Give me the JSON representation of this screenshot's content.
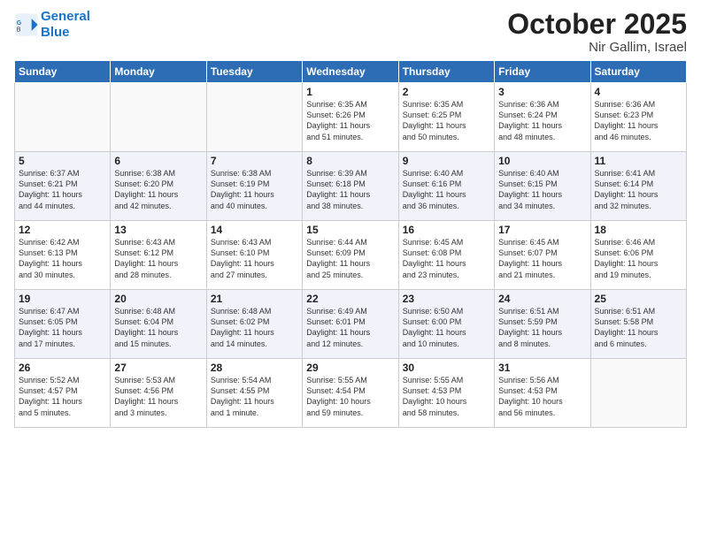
{
  "header": {
    "logo_line1": "General",
    "logo_line2": "Blue",
    "month": "October 2025",
    "location": "Nir Gallim, Israel"
  },
  "weekdays": [
    "Sunday",
    "Monday",
    "Tuesday",
    "Wednesday",
    "Thursday",
    "Friday",
    "Saturday"
  ],
  "weeks": [
    [
      {
        "day": "",
        "info": ""
      },
      {
        "day": "",
        "info": ""
      },
      {
        "day": "",
        "info": ""
      },
      {
        "day": "1",
        "info": "Sunrise: 6:35 AM\nSunset: 6:26 PM\nDaylight: 11 hours\nand 51 minutes."
      },
      {
        "day": "2",
        "info": "Sunrise: 6:35 AM\nSunset: 6:25 PM\nDaylight: 11 hours\nand 50 minutes."
      },
      {
        "day": "3",
        "info": "Sunrise: 6:36 AM\nSunset: 6:24 PM\nDaylight: 11 hours\nand 48 minutes."
      },
      {
        "day": "4",
        "info": "Sunrise: 6:36 AM\nSunset: 6:23 PM\nDaylight: 11 hours\nand 46 minutes."
      }
    ],
    [
      {
        "day": "5",
        "info": "Sunrise: 6:37 AM\nSunset: 6:21 PM\nDaylight: 11 hours\nand 44 minutes."
      },
      {
        "day": "6",
        "info": "Sunrise: 6:38 AM\nSunset: 6:20 PM\nDaylight: 11 hours\nand 42 minutes."
      },
      {
        "day": "7",
        "info": "Sunrise: 6:38 AM\nSunset: 6:19 PM\nDaylight: 11 hours\nand 40 minutes."
      },
      {
        "day": "8",
        "info": "Sunrise: 6:39 AM\nSunset: 6:18 PM\nDaylight: 11 hours\nand 38 minutes."
      },
      {
        "day": "9",
        "info": "Sunrise: 6:40 AM\nSunset: 6:16 PM\nDaylight: 11 hours\nand 36 minutes."
      },
      {
        "day": "10",
        "info": "Sunrise: 6:40 AM\nSunset: 6:15 PM\nDaylight: 11 hours\nand 34 minutes."
      },
      {
        "day": "11",
        "info": "Sunrise: 6:41 AM\nSunset: 6:14 PM\nDaylight: 11 hours\nand 32 minutes."
      }
    ],
    [
      {
        "day": "12",
        "info": "Sunrise: 6:42 AM\nSunset: 6:13 PM\nDaylight: 11 hours\nand 30 minutes."
      },
      {
        "day": "13",
        "info": "Sunrise: 6:43 AM\nSunset: 6:12 PM\nDaylight: 11 hours\nand 28 minutes."
      },
      {
        "day": "14",
        "info": "Sunrise: 6:43 AM\nSunset: 6:10 PM\nDaylight: 11 hours\nand 27 minutes."
      },
      {
        "day": "15",
        "info": "Sunrise: 6:44 AM\nSunset: 6:09 PM\nDaylight: 11 hours\nand 25 minutes."
      },
      {
        "day": "16",
        "info": "Sunrise: 6:45 AM\nSunset: 6:08 PM\nDaylight: 11 hours\nand 23 minutes."
      },
      {
        "day": "17",
        "info": "Sunrise: 6:45 AM\nSunset: 6:07 PM\nDaylight: 11 hours\nand 21 minutes."
      },
      {
        "day": "18",
        "info": "Sunrise: 6:46 AM\nSunset: 6:06 PM\nDaylight: 11 hours\nand 19 minutes."
      }
    ],
    [
      {
        "day": "19",
        "info": "Sunrise: 6:47 AM\nSunset: 6:05 PM\nDaylight: 11 hours\nand 17 minutes."
      },
      {
        "day": "20",
        "info": "Sunrise: 6:48 AM\nSunset: 6:04 PM\nDaylight: 11 hours\nand 15 minutes."
      },
      {
        "day": "21",
        "info": "Sunrise: 6:48 AM\nSunset: 6:02 PM\nDaylight: 11 hours\nand 14 minutes."
      },
      {
        "day": "22",
        "info": "Sunrise: 6:49 AM\nSunset: 6:01 PM\nDaylight: 11 hours\nand 12 minutes."
      },
      {
        "day": "23",
        "info": "Sunrise: 6:50 AM\nSunset: 6:00 PM\nDaylight: 11 hours\nand 10 minutes."
      },
      {
        "day": "24",
        "info": "Sunrise: 6:51 AM\nSunset: 5:59 PM\nDaylight: 11 hours\nand 8 minutes."
      },
      {
        "day": "25",
        "info": "Sunrise: 6:51 AM\nSunset: 5:58 PM\nDaylight: 11 hours\nand 6 minutes."
      }
    ],
    [
      {
        "day": "26",
        "info": "Sunrise: 5:52 AM\nSunset: 4:57 PM\nDaylight: 11 hours\nand 5 minutes."
      },
      {
        "day": "27",
        "info": "Sunrise: 5:53 AM\nSunset: 4:56 PM\nDaylight: 11 hours\nand 3 minutes."
      },
      {
        "day": "28",
        "info": "Sunrise: 5:54 AM\nSunset: 4:55 PM\nDaylight: 11 hours\nand 1 minute."
      },
      {
        "day": "29",
        "info": "Sunrise: 5:55 AM\nSunset: 4:54 PM\nDaylight: 10 hours\nand 59 minutes."
      },
      {
        "day": "30",
        "info": "Sunrise: 5:55 AM\nSunset: 4:53 PM\nDaylight: 10 hours\nand 58 minutes."
      },
      {
        "day": "31",
        "info": "Sunrise: 5:56 AM\nSunset: 4:53 PM\nDaylight: 10 hours\nand 56 minutes."
      },
      {
        "day": "",
        "info": ""
      }
    ]
  ]
}
